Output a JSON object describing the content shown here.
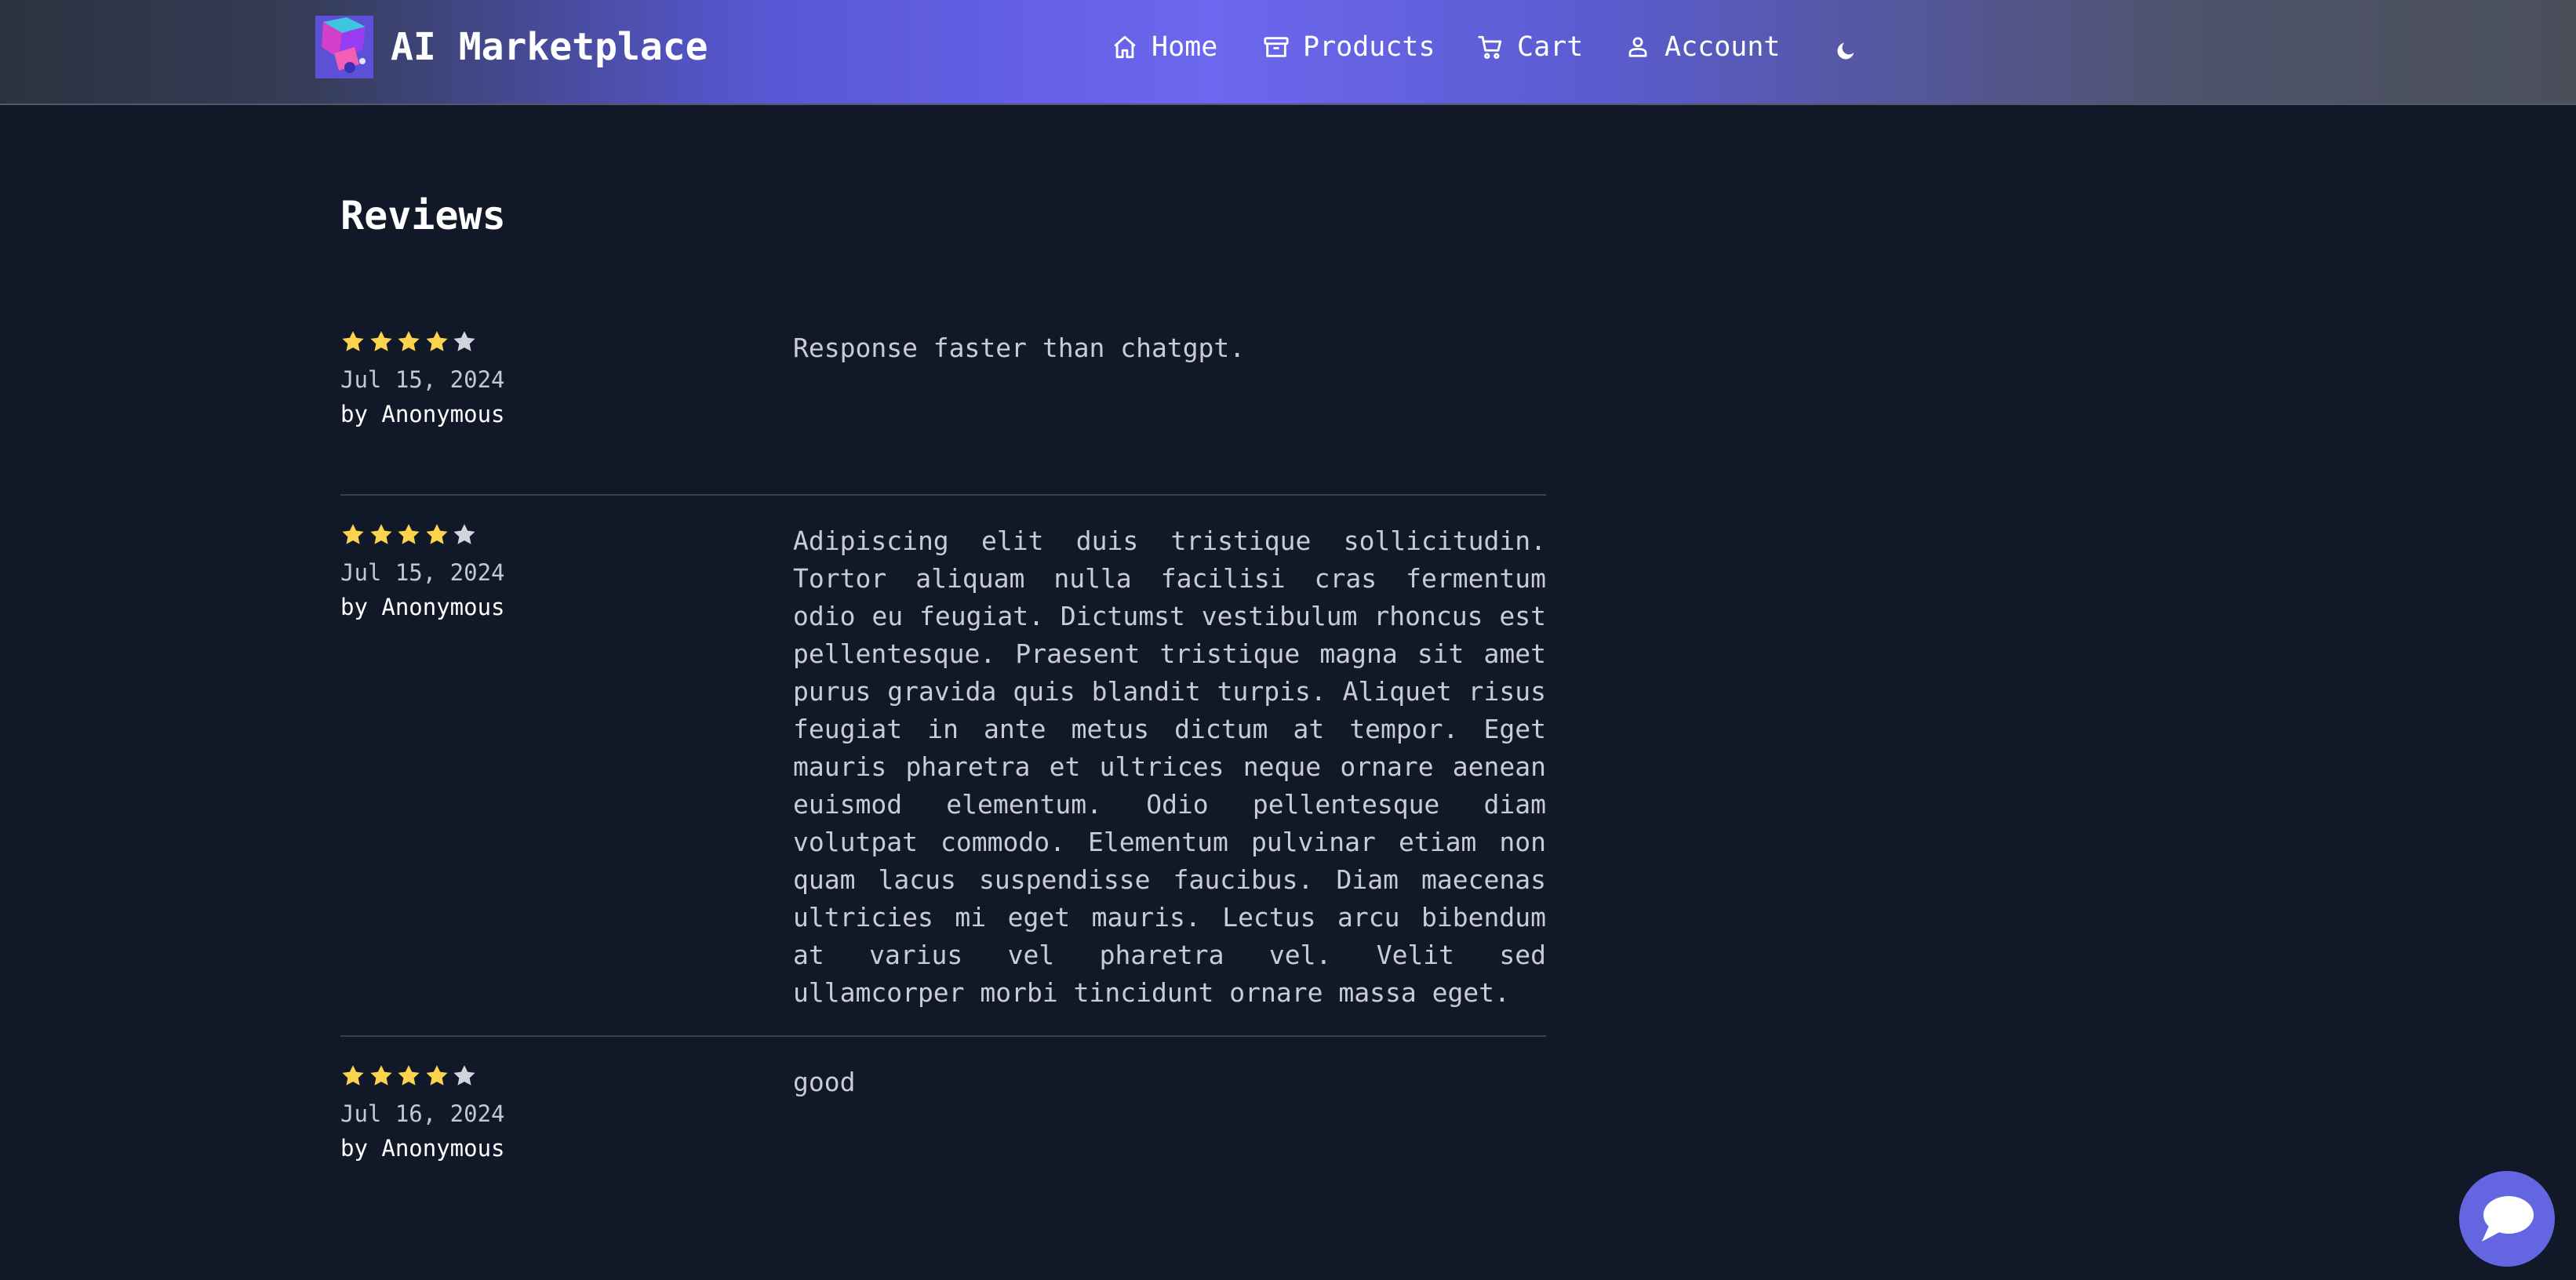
{
  "header": {
    "brand": "AI Marketplace",
    "nav": [
      {
        "label": "Home",
        "icon": "home-icon"
      },
      {
        "label": "Products",
        "icon": "archive-box-icon"
      },
      {
        "label": "Cart",
        "icon": "cart-icon"
      },
      {
        "label": "Account",
        "icon": "user-icon"
      }
    ],
    "theme_toggle_icon": "moon-icon"
  },
  "main": {
    "title": "Reviews",
    "reviews": [
      {
        "rating": 4,
        "max_rating": 5,
        "date": "Jul 15, 2024",
        "author": "by Anonymous",
        "text": "Response faster than chatgpt."
      },
      {
        "rating": 4,
        "max_rating": 5,
        "date": "Jul 15, 2024",
        "author": "by Anonymous",
        "text": "Adipiscing elit duis tristique sollicitudin. Tortor aliquam nulla facilisi cras fermentum odio eu feugiat. Dictumst vestibulum rhoncus est pellentesque. Praesent tristique magna sit amet purus gravida quis blandit turpis. Aliquet risus feugiat in ante metus dictum at tempor. Eget mauris pharetra et ultrices neque ornare aenean euismod elementum. Odio pellentesque diam volutpat commodo. Elementum pulvinar etiam non quam lacus suspendisse faucibus. Diam maecenas ultricies mi eget mauris. Lectus arcu bibendum at varius vel pharetra vel. Velit sed ullamcorper morbi tincidunt ornare massa eget."
      },
      {
        "rating": 4,
        "max_rating": 5,
        "date": "Jul 16, 2024",
        "author": "by Anonymous",
        "text": "good"
      }
    ]
  },
  "chat_widget": {
    "icon": "chat-bubble-icon"
  },
  "colors": {
    "background": "#111827",
    "star_filled": "#fcd34d",
    "star_empty": "#d1d5db",
    "accent": "#6366e0"
  }
}
